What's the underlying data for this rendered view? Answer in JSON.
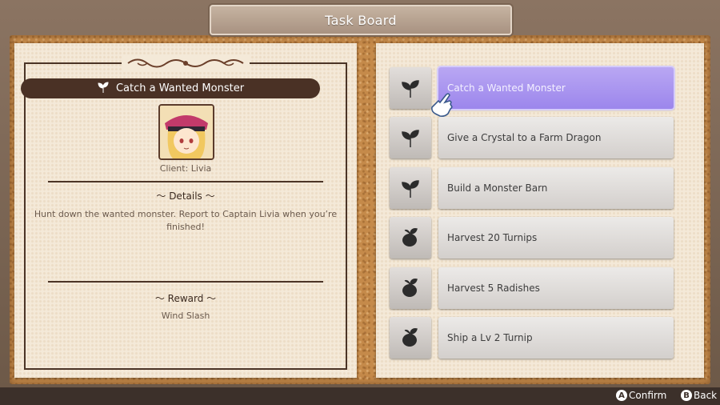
{
  "header": {
    "title": "Task Board"
  },
  "detail": {
    "task_title": "Catch a Wanted Monster",
    "client": "Client: Livia",
    "details_heading": "～  Details  ～",
    "details_text": "Hunt down the wanted monster. Report to Captain Livia when you’re finished!",
    "reward_heading": "～  Reward  ～",
    "reward_value": "Wind Slash"
  },
  "tasks": [
    {
      "label": "Catch a Wanted Monster",
      "icon": "sprout-icon",
      "selected": true
    },
    {
      "label": "Give a Crystal to a Farm Dragon",
      "icon": "sprout-icon",
      "selected": false
    },
    {
      "label": "Build a Monster Barn",
      "icon": "sprout-icon",
      "selected": false
    },
    {
      "label": "Harvest 20 Turnips",
      "icon": "turnip-icon",
      "selected": false
    },
    {
      "label": "Harvest 5 Radishes",
      "icon": "turnip-icon",
      "selected": false
    },
    {
      "label": "Ship a Lv 2 Turnip",
      "icon": "turnip-icon",
      "selected": false
    }
  ],
  "footer": {
    "confirm_key": "A",
    "confirm_label": "Confirm",
    "back_key": "B",
    "back_label": "Back"
  },
  "colors": {
    "selected": "#9c86ec",
    "title_bar": "#4a3125",
    "cork": "#c58a4a"
  }
}
